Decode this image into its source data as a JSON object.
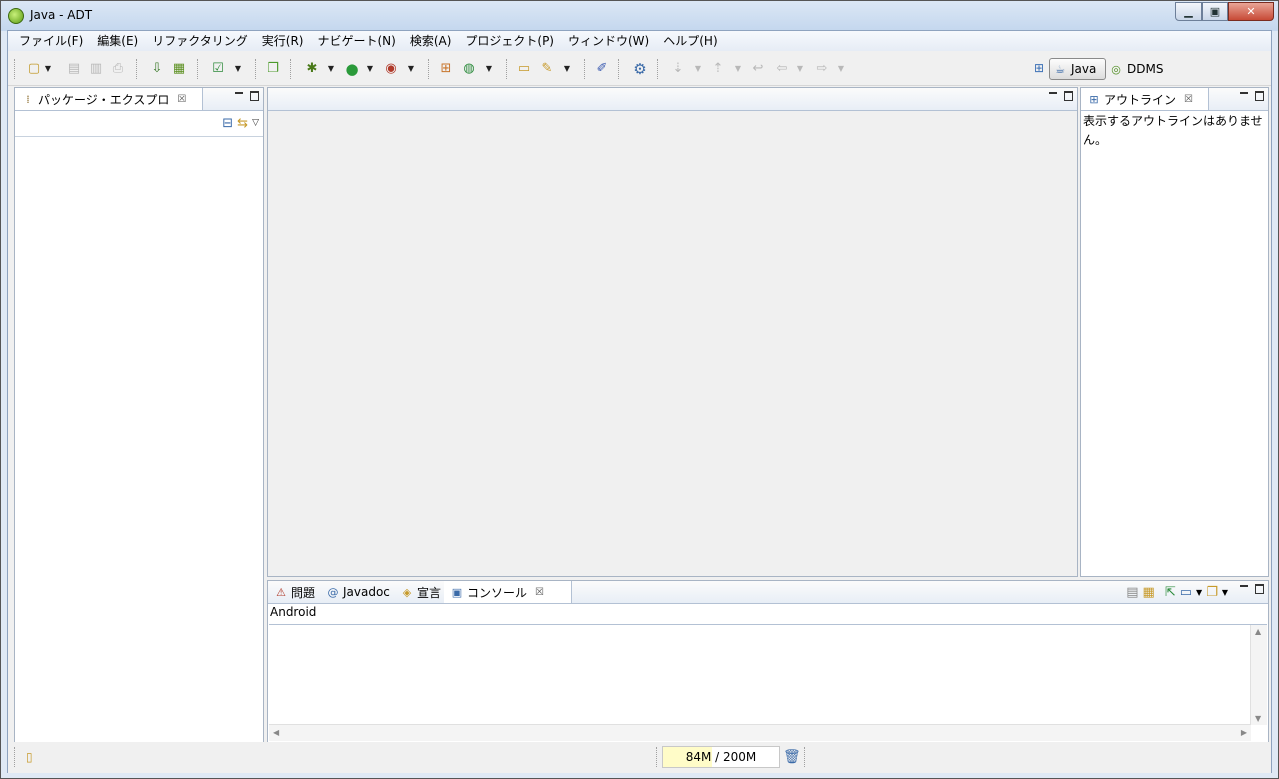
{
  "window": {
    "title": "Java - ADT"
  },
  "menu": [
    "ファイル(F)",
    "編集(E)",
    "リファクタリング",
    "実行(R)",
    "ナビゲート(N)",
    "検索(A)",
    "プロジェクト(P)",
    "ウィンドウ(W)",
    "ヘルプ(H)"
  ],
  "perspectives": {
    "java": "Java",
    "ddms": "DDMS"
  },
  "package_explorer": {
    "tab": "パッケージ・エクスプロ"
  },
  "outline": {
    "tab": "アウトライン",
    "message": "表示するアウトラインはありません。"
  },
  "bottom_tabs": {
    "problems": "問題",
    "javadoc": "Javadoc",
    "declaration": "宣言",
    "console": "コンソール"
  },
  "console": {
    "label": "Android"
  },
  "status": {
    "heap_used": "84M",
    "heap_sep": " / ",
    "heap_total": "200M",
    "heap_fraction": 0.42
  },
  "icons": [
    "app-icon",
    "new-icon",
    "save-icon",
    "save-all-icon",
    "print-icon",
    "sdk-manager-icon",
    "avd-manager-icon",
    "lint-icon",
    "new-android-project-icon",
    "debug-icon",
    "run-icon",
    "external-tools-icon",
    "new-java-package-icon",
    "new-class-icon",
    "open-type-icon",
    "search-icon",
    "toggle-mark-icon",
    "settings-icon",
    "next-annotation-icon",
    "prev-annotation-icon",
    "last-edit-icon",
    "back-icon",
    "forward-icon",
    "open-perspective-icon",
    "java-perspective-icon",
    "ddms-perspective-icon",
    "collapse-all-icon",
    "link-editor-icon",
    "view-menu-icon",
    "gc-trash-icon"
  ]
}
